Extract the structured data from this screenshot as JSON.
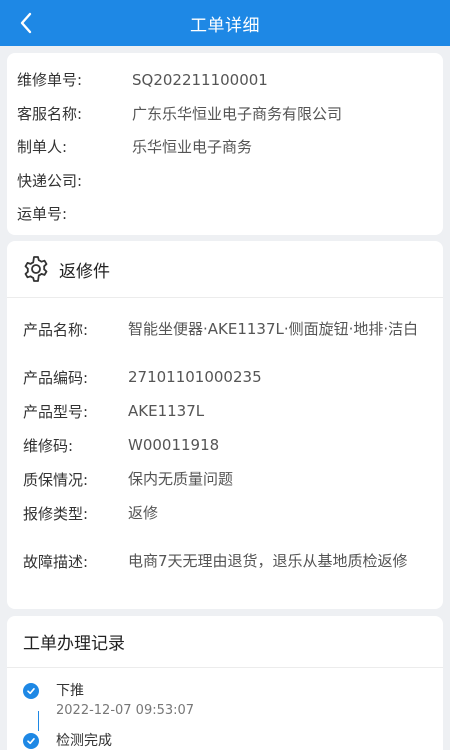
{
  "header": {
    "title": "工单详细"
  },
  "basic": [
    {
      "label": "维修单号:",
      "value": "SQ202211100001"
    },
    {
      "label": "客服名称:",
      "value": "广东乐华恒业电子商务有限公司"
    },
    {
      "label": "制单人:",
      "value": "乐华恒业电子商务"
    },
    {
      "label": "快递公司:",
      "value": ""
    },
    {
      "label": "运单号:",
      "value": ""
    }
  ],
  "return_section": {
    "title": "返修件",
    "rows": [
      {
        "label": "产品名称:",
        "value": "智能坐便器·AKE1137L·侧面旋钮·地排·洁白"
      },
      {
        "label": "产品编码:",
        "value": "27101101000235"
      },
      {
        "label": "产品型号:",
        "value": "AKE1137L"
      },
      {
        "label": "维修码:",
        "value": "W00011918"
      },
      {
        "label": "质保情况:",
        "value": "保内无质量问题"
      },
      {
        "label": "报修类型:",
        "value": "返修"
      },
      {
        "label": "故障描述:",
        "value": "电商7天无理由退货，退乐从基地质检返修"
      }
    ]
  },
  "records": {
    "title": "工单办理记录",
    "items": [
      {
        "name": "下推",
        "time": "2022-12-07 09:53:07"
      },
      {
        "name": "检测完成",
        "time": ""
      }
    ]
  },
  "colors": {
    "accent": "#1e88e5",
    "background": "#eef0f3"
  },
  "icons": {
    "back": "chevron-left-icon",
    "section": "gear-icon",
    "timeline": "check-circle-icon"
  }
}
